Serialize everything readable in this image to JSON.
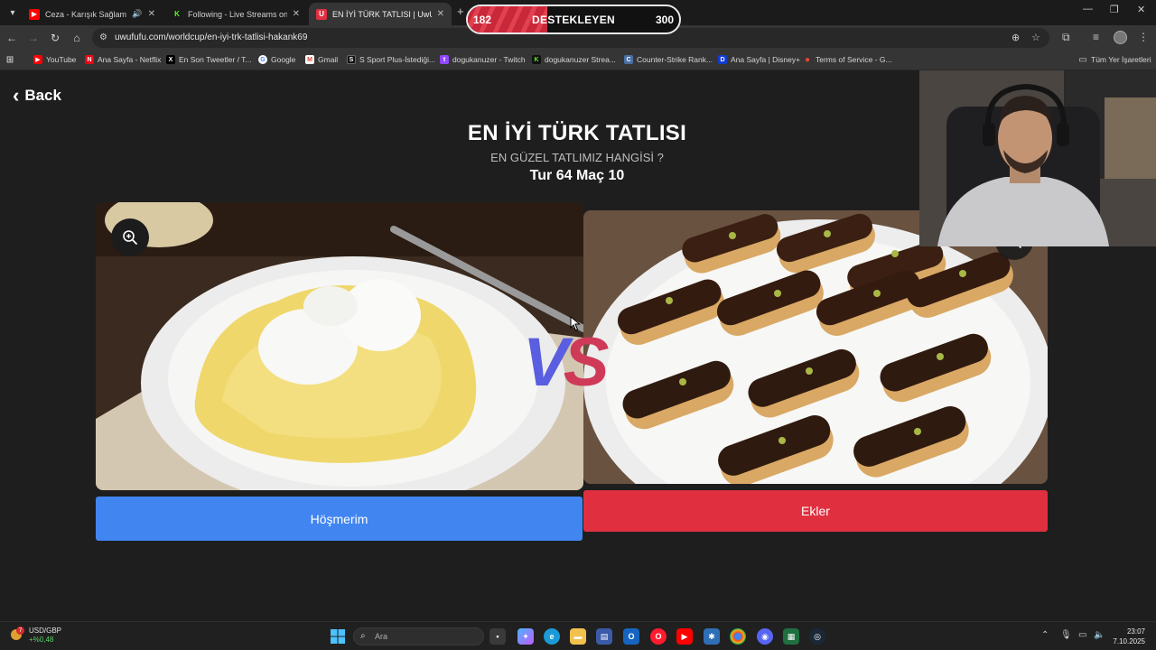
{
  "browser": {
    "tabs": [
      {
        "title": "Ceza - Karışık Sağlam Albüm",
        "favicon": "youtube-icon",
        "audio": true,
        "active": false
      },
      {
        "title": "Following - Live Streams on Kick",
        "favicon": "kick-icon",
        "audio": false,
        "active": false
      },
      {
        "title": "EN İYİ TÜRK TATLISI | UwUFUFU",
        "favicon": "uwufufu-icon",
        "audio": false,
        "active": true
      }
    ],
    "new_tab_label": "+",
    "url": "uwufufu.com/worldcup/en-iyi-trk-tatlisi-hakank69",
    "bookmarks": [
      {
        "label": "YouTube",
        "icon": "youtube-icon",
        "color": "#ff0000"
      },
      {
        "label": "Ana Sayfa - Netflix",
        "icon": "netflix-icon",
        "color": "#e50914"
      },
      {
        "label": "En Son Tweetler / T...",
        "icon": "x-icon",
        "color": "#000000"
      },
      {
        "label": "Google",
        "icon": "google-icon",
        "color": "#4285f4"
      },
      {
        "label": "Gmail",
        "icon": "gmail-icon",
        "color": "#ea4335"
      },
      {
        "label": "S Sport Plus-İstediği...",
        "icon": "ssport-icon",
        "color": "#000000"
      },
      {
        "label": "dogukanuzer - Twitch",
        "icon": "twitch-icon",
        "color": "#9146ff"
      },
      {
        "label": "dogukanuzer Strea...",
        "icon": "kick-icon",
        "color": "#53fc18"
      },
      {
        "label": "Counter-Strike Rank...",
        "icon": "cs-icon",
        "color": "#4a6fa5"
      },
      {
        "label": "Ana Sayfa | Disney+",
        "icon": "disney-icon",
        "color": "#113ccf"
      },
      {
        "label": "Terms of Service - G...",
        "icon": "map-pin-icon",
        "color": "#ea4335"
      }
    ],
    "all_bookmarks": "Tüm Yer İşaretleri"
  },
  "page": {
    "back_label": "Back",
    "title": "EN İYİ TÜRK TATLISI",
    "subtitle": "EN GÜZEL TATLIMIZ HANGİSİ ?",
    "round": "Tur 64 Maç 10",
    "vs_v": "V",
    "vs_s": "S",
    "left_choice": "Höşmerim",
    "right_choice": "Ekler",
    "colors": {
      "left": "#4185f0",
      "right": "#e0303f",
      "vs_v": "#5a5ee0",
      "vs_s": "#cf3a59"
    }
  },
  "overlay": {
    "support_label": "DESTEKLEYEN",
    "support_left": "182",
    "support_right": "300",
    "support_ratio": 0.3776
  },
  "taskbar": {
    "weather_pair": "USD/GBP",
    "weather_change": "+%0,48",
    "weather_badge": "7",
    "search_placeholder": "Ara",
    "time": "23:07",
    "date": "7.10.2025"
  }
}
